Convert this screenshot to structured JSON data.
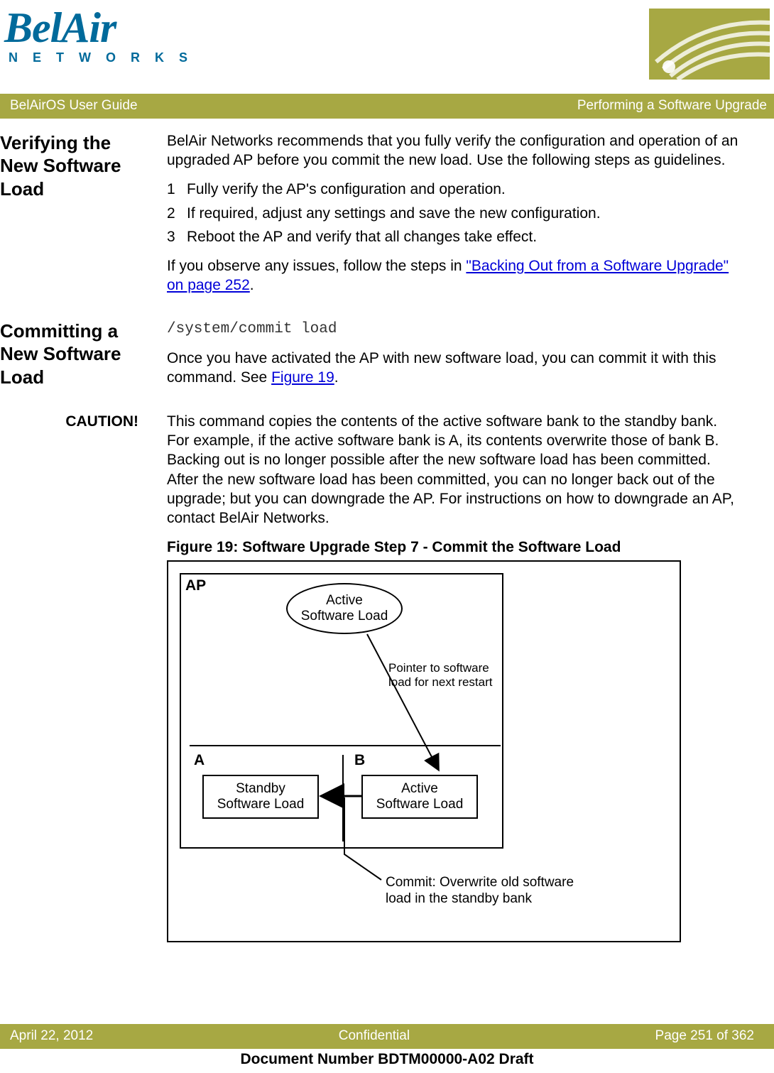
{
  "header": {
    "logo_top": "BelAir",
    "logo_bottom": "N E T W O R K S"
  },
  "title_bar": {
    "left": "BelAirOS User Guide",
    "right": "Performing a Software Upgrade"
  },
  "section1": {
    "heading": "Verifying the New Software Load",
    "intro": "BelAir Networks recommends that you fully verify the configuration and operation of an upgraded AP before you commit the new load. Use the following steps as guidelines.",
    "steps": [
      {
        "n": "1",
        "text": "Fully verify the AP's configuration and operation."
      },
      {
        "n": "2",
        "text": "If required, adjust any settings and save the new configuration."
      },
      {
        "n": "3",
        "text": "Reboot the AP and verify that all changes take effect."
      }
    ],
    "outro_pre": "If you observe any issues, follow the steps in ",
    "outro_link": "\"Backing Out from a Software Upgrade\" on page 252",
    "outro_post": "."
  },
  "section2": {
    "heading": "Committing a New Software Load",
    "command": "/system/commit load",
    "body_pre": "Once you have activated the AP with new software load, you can commit it with this command. See ",
    "body_link": "Figure 19",
    "body_post": "."
  },
  "caution": {
    "label": "CAUTION!",
    "text": "This command copies the contents of the active software bank to the standby bank. For example, if the active software bank is A, its contents overwrite those of bank B. Backing out is no longer possible after the new software load has been committed. After the new software load has been committed, you can no longer back out of the upgrade; but you can downgrade the AP. For instructions on how to downgrade an AP, contact BelAir Networks."
  },
  "figure": {
    "caption": "Figure 19: Software Upgrade Step 7 - Commit the Software Load",
    "ap_label": "AP",
    "ellipse_line1": "Active",
    "ellipse_line2": "Software Load",
    "pointer_line1": "Pointer to software",
    "pointer_line2": "load for next restart",
    "bank_a_label": "A",
    "bank_b_label": "B",
    "bank_a_line1": "Standby",
    "bank_a_line2": "Software Load",
    "bank_b_line1": "Active",
    "bank_b_line2": "Software Load",
    "commit_line1": "Commit: Overwrite old software",
    "commit_line2": "load in the standby bank"
  },
  "footer": {
    "left": "April 22, 2012",
    "center": "Confidential",
    "right": "Page 251 of 362",
    "doc": "Document Number BDTM00000-A02 Draft"
  }
}
